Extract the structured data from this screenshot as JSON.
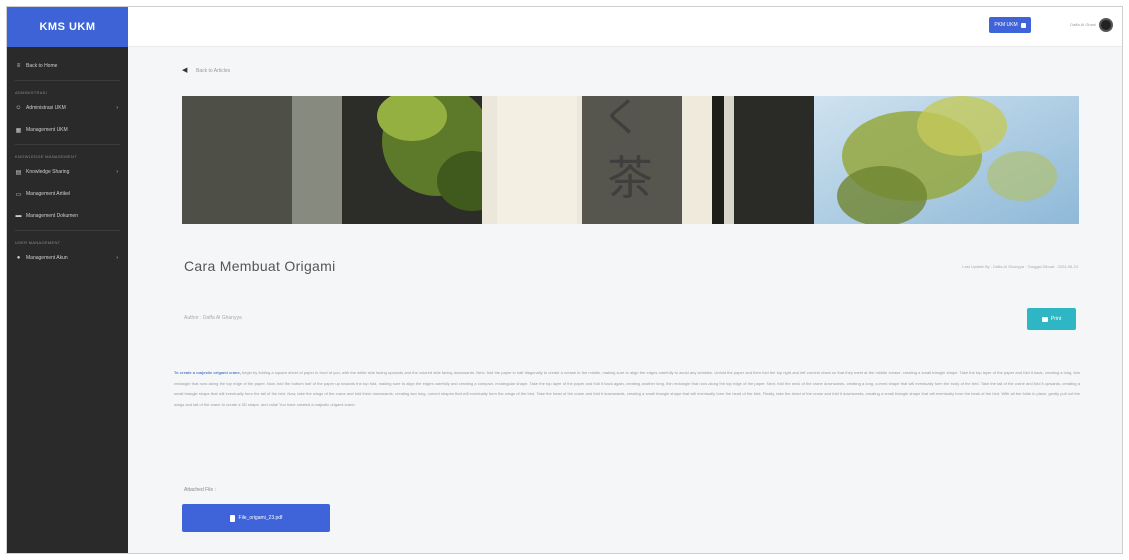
{
  "app": {
    "brand": "KMS UKM"
  },
  "sidebar": {
    "items": [
      {
        "label": "Back to Home",
        "icon": "list-icon"
      },
      {
        "section": "ADMINISTRASI"
      },
      {
        "label": "Administrasi UKM",
        "icon": "users-icon",
        "chevron": true
      },
      {
        "label": "Management UKM",
        "icon": "building-icon"
      },
      {
        "section": "KNOWLEDGE MANAGEMENT"
      },
      {
        "label": "Knowledge Sharing",
        "icon": "book-icon",
        "chevron": true
      },
      {
        "label": "Management Artikel",
        "icon": "file-icon"
      },
      {
        "label": "Management Dokumen",
        "icon": "folder-icon"
      },
      {
        "section": "USER MANAGEMENT"
      },
      {
        "label": "Management Akun",
        "icon": "user-icon",
        "chevron": true
      }
    ]
  },
  "topbar": {
    "pill_label": "PKM UKM",
    "user_name": "Daffa Al Ghani",
    "avatar_icon": "avatar-icon"
  },
  "article": {
    "back_label": "Back to Articles",
    "title": "Cara Membuat Origami",
    "meta": "Last Update By : Daffa Al Ghanyya · Tanggal Dibuat : 2024-06-24",
    "author": "Author : Daffa Al Ghanyya",
    "print_label": "Print",
    "lead": "To create a majestic origami crane,",
    "body": " begin by folding a square sheet of paper in front of you, with the white side facing upwards and the colored side facing downwards. Next, fold the paper in half diagonally to create a crease in the middle, making sure to align the edges carefully to avoid any wrinkles. Unfold the paper and then fold the top right and left corners down so that they meet at the middle crease, creating a small triangle shape. Take the top layer of the paper and fold it back, creating a long, thin rectangle that runs along the top edge of the paper. Now, fold the bottom half of the paper up towards the top fold, making sure to align the edges carefully and creating a compact, rectangular shape. Take the top layer of the paper and fold it back again, creating another long, thin rectangle that runs along the top edge of the paper. Next, fold the neck of the crane downwards, creating a long, curved shape that will eventually form the body of the bird. Take the tail of the crane and fold it upwards, creating a small triangle shape that will eventually form the tail of the bird. Now, take the wings of the crane and fold them downwards, creating two long, curved shapes that will eventually form the wings of the bird. Take the head of the crane and fold it downwards, creating a small triangle shape that will eventually form the head of the bird. Finally, take the head of the crane and fold it downwards, creating a small triangle shape that will eventually form the beak of the bird. With all the folds in place, gently pull out the wings and tail of the crane to create a 3D shape, and voila! You have created a majestic origami crane.",
    "attached_label": "Attached File :",
    "file_label": "File_origami_23.pdf"
  },
  "colors": {
    "accent": "#3f63d8",
    "sidebar_bg": "#2a2a2a",
    "print_bg": "#2fb6c4"
  }
}
